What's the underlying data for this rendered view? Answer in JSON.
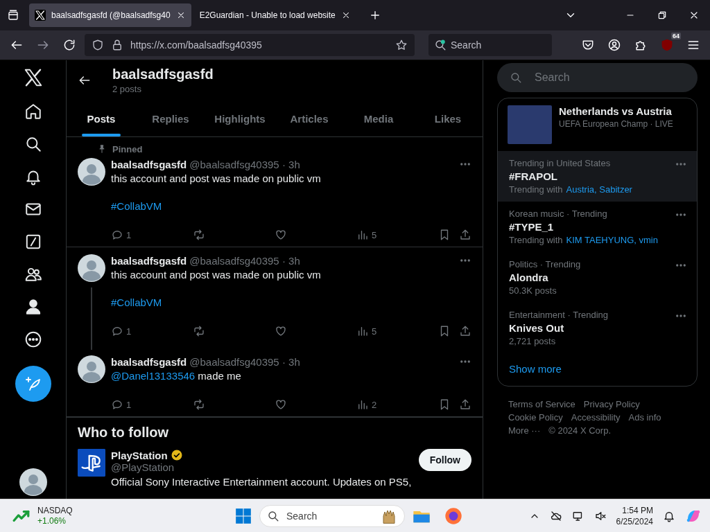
{
  "browser": {
    "tabs": [
      {
        "title": "baalsadfsgasfd (@baalsadfsg40",
        "selected": true
      },
      {
        "title": "E2Guardian - Unable to load website",
        "selected": false
      }
    ],
    "url": "https://x.com/baalsadfsg40395",
    "search_placeholder": "Search",
    "extension_badge": "64"
  },
  "profile": {
    "name": "baalsadfsgasfd",
    "post_count": "2 posts"
  },
  "profile_tabs": [
    {
      "label": "Posts",
      "selected": true
    },
    {
      "label": "Replies",
      "selected": false
    },
    {
      "label": "Highlights",
      "selected": false
    },
    {
      "label": "Articles",
      "selected": false
    },
    {
      "label": "Media",
      "selected": false
    },
    {
      "label": "Likes",
      "selected": false
    }
  ],
  "posts": [
    {
      "pinned_label": "Pinned",
      "name": "baalsadfsgasfd",
      "meta": "@baalsadfsg40395 · 3h",
      "paragraphs": [
        [
          {
            "kind": "text",
            "text": "this account and post was made on public vm"
          }
        ],
        [
          {
            "kind": "link",
            "text": "#CollabVM"
          }
        ]
      ],
      "replies": "1",
      "views": "5",
      "thread_line": false
    },
    {
      "name": "baalsadfsgasfd",
      "meta": "@baalsadfsg40395 · 3h",
      "paragraphs": [
        [
          {
            "kind": "text",
            "text": "this account and post was made on public vm"
          }
        ],
        [
          {
            "kind": "link",
            "text": "#CollabVM"
          }
        ]
      ],
      "replies": "1",
      "views": "5",
      "thread_line": true
    },
    {
      "name": "baalsadfsgasfd",
      "meta": "@baalsadfsg40395 · 3h",
      "paragraphs": [
        [
          {
            "kind": "link",
            "text": "@Danel13133546"
          },
          {
            "kind": "text",
            "text": " made me"
          }
        ]
      ],
      "replies": "1",
      "views": "2",
      "thread_line": false
    }
  ],
  "who_to_follow": {
    "title": "Who to follow",
    "accounts": [
      {
        "name": "PlayStation",
        "verified": true,
        "handle": "@PlayStation",
        "bio": "Official Sony Interactive Entertainment account. Updates on PS5,",
        "button": "Follow"
      }
    ]
  },
  "sidebar": {
    "search_placeholder": "Search",
    "trends": [
      {
        "kind": "event",
        "title": "Netherlands vs Austria",
        "context": "UEFA European Champ · LIVE",
        "highlighted": false
      },
      {
        "kind": "trend",
        "context": "Trending in United States",
        "title": "#FRAPOL",
        "with_label": "Trending with",
        "with_links": "Austria, Sabitzer",
        "highlighted": true
      },
      {
        "kind": "trend",
        "context": "Korean music · Trending",
        "title": "#TYPE_1",
        "with_label": "Trending with",
        "with_links": "KIM TAEHYUNG, vmin",
        "highlighted": false
      },
      {
        "kind": "trend",
        "context": "Politics · Trending",
        "title": "Alondra",
        "posts": "50.3K posts",
        "highlighted": false
      },
      {
        "kind": "trend",
        "context": "Entertainment · Trending",
        "title": "Knives Out",
        "posts": "2,721 posts",
        "highlighted": false
      }
    ],
    "show_more": "Show more",
    "footer_links": [
      "Terms of Service",
      "Privacy Policy",
      "Cookie Policy",
      "Accessibility",
      "Ads info",
      "More ···"
    ],
    "copyright": "© 2024 X Corp."
  },
  "taskbar": {
    "widget_name": "NASDAQ",
    "widget_change": "+1.06%",
    "search_placeholder": "Search",
    "time": "1:54 PM",
    "date": "6/25/2024"
  }
}
